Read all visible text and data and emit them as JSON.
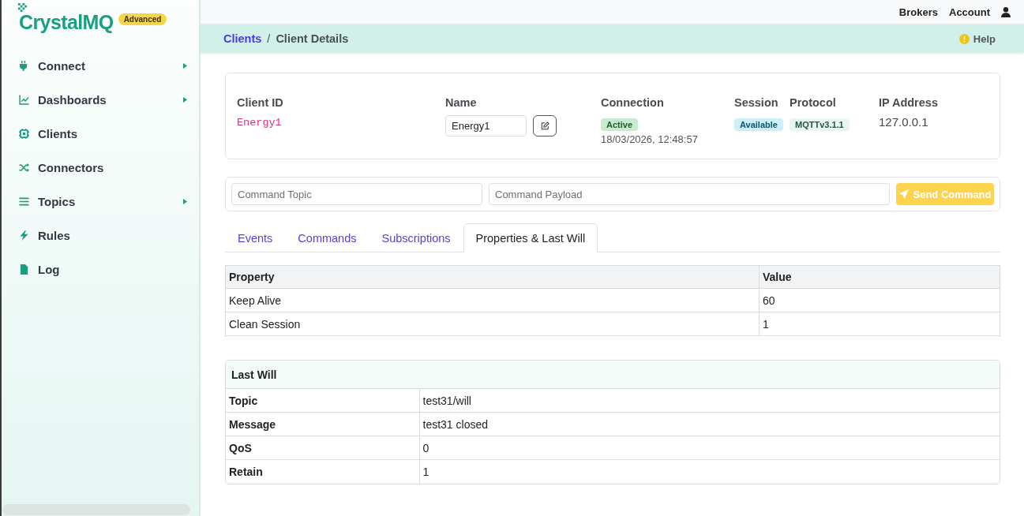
{
  "sidebar": {
    "logo": {
      "name": "CrystalMQ",
      "badge": "Advanced"
    },
    "items": [
      {
        "label": "Connect",
        "submenu": true
      },
      {
        "label": "Dashboards",
        "submenu": true
      },
      {
        "label": "Clients",
        "submenu": false
      },
      {
        "label": "Connectors",
        "submenu": false
      },
      {
        "label": "Topics",
        "submenu": true
      },
      {
        "label": "Rules",
        "submenu": false
      },
      {
        "label": "Log",
        "submenu": false
      }
    ]
  },
  "top_bar": {
    "links": [
      "Brokers",
      "Account"
    ]
  },
  "breadcrumb": {
    "items": [
      {
        "label": "Clients",
        "link": true
      },
      {
        "label": "Client Details",
        "link": false
      }
    ],
    "separator": "/",
    "help": "Help"
  },
  "client": {
    "fields": [
      {
        "kind": "code",
        "label": "Client ID",
        "value": "Energy1"
      },
      {
        "kind": "editable",
        "label": "Name",
        "value": "Energy1"
      },
      {
        "kind": "status",
        "label": "Connection",
        "badge": "Active",
        "color": "#c6ebd0",
        "since": "18/03/2026, 12:48:57"
      },
      {
        "kind": "badge",
        "label": "Session",
        "badge": "Available",
        "color": "#cdeffa"
      },
      {
        "kind": "badge",
        "label": "Protocol",
        "badge": "MQTTv3.1.1",
        "color": "#e9f5f2"
      },
      {
        "kind": "text",
        "label": "IP Address",
        "value": "127.0.0.1"
      }
    ]
  },
  "command": {
    "topic": {
      "placeholder": "Command Topic"
    },
    "payload": {
      "placeholder": "Command Payload"
    },
    "button": "Send Command"
  },
  "tabs": [
    {
      "label": "Events",
      "selected": false
    },
    {
      "label": "Commands",
      "selected": false
    },
    {
      "label": "Subscriptions",
      "selected": false
    },
    {
      "label": "Properties & Last Will",
      "selected": true
    }
  ],
  "properties": {
    "columns": [
      "Property",
      "Value"
    ],
    "rows": [
      [
        "Keep Alive",
        "60"
      ],
      [
        "Clean Session",
        "1"
      ]
    ]
  },
  "last_will": {
    "title": "Last Will",
    "rows": [
      {
        "label": "Topic",
        "value": "test31/will"
      },
      {
        "label": "Message",
        "value": "test31 closed"
      },
      {
        "label": "QoS",
        "value": "0"
      },
      {
        "label": "Retain",
        "value": "1"
      }
    ]
  }
}
